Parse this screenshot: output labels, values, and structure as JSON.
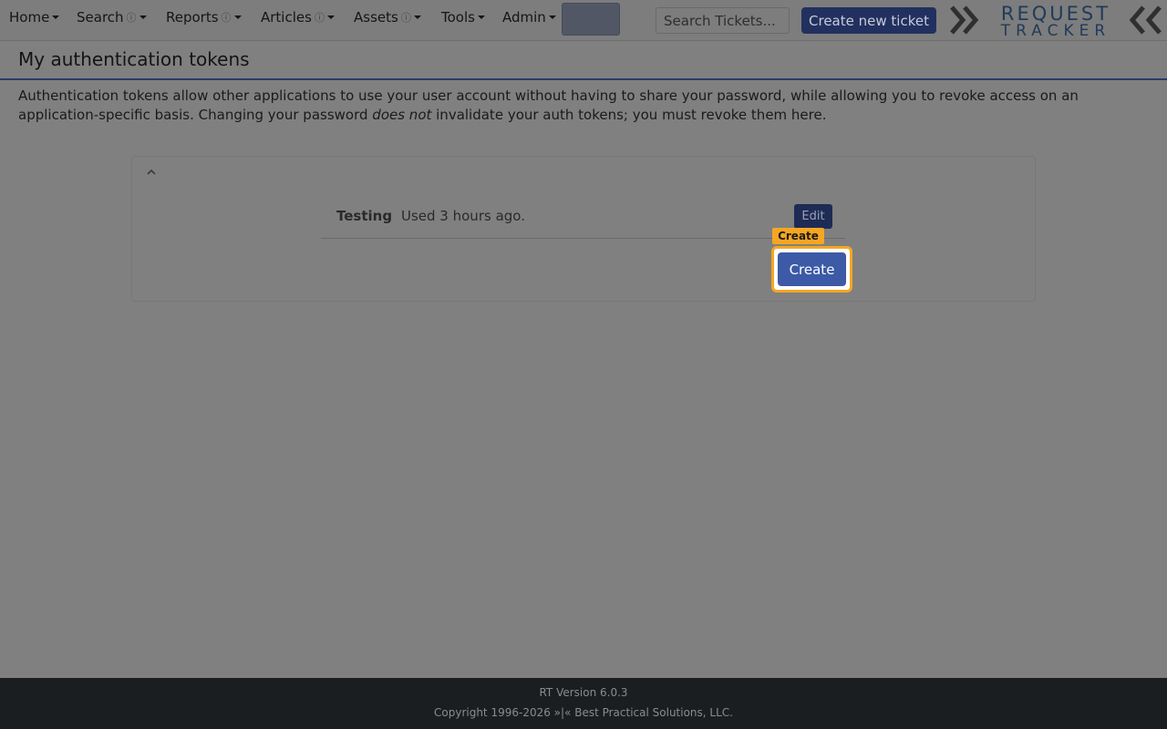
{
  "nav": {
    "items": [
      {
        "label": "Home"
      },
      {
        "label": "Search"
      },
      {
        "label": "Reports"
      },
      {
        "label": "Articles"
      },
      {
        "label": "Assets"
      },
      {
        "label": "Tools"
      },
      {
        "label": "Admin"
      }
    ],
    "info_glyph": "ⓘ",
    "search_placeholder": "Search Tickets...",
    "create_ticket_label": "Create new ticket",
    "logo_top": "REQUEST",
    "logo_bottom": "TRACKER"
  },
  "page": {
    "title": "My authentication tokens",
    "intro_before": "Authentication tokens allow other applications to use your user account without having to share your password, while allowing you to revoke access on an application-specific basis. Changing your password ",
    "intro_emphasis": "does not",
    "intro_after": " invalidate your auth tokens; you must revoke them here."
  },
  "tokens": [
    {
      "name": "Testing",
      "usage": "Used 3 hours ago.",
      "edit_label": "Edit"
    }
  ],
  "actions": {
    "create_label": "Create",
    "highlight_label": "Create"
  },
  "footer": {
    "version": "RT Version 6.0.3",
    "copyright": "Copyright 1996-2026 »|« Best Practical Solutions, LLC."
  },
  "colors": {
    "accent": "#3c5aa6",
    "highlight": "#f5a623",
    "overlay": "#808080"
  },
  "icons": {
    "collapse": "chevron-up-icon",
    "dropdown": "caret-down-icon",
    "info": "info-icon"
  }
}
